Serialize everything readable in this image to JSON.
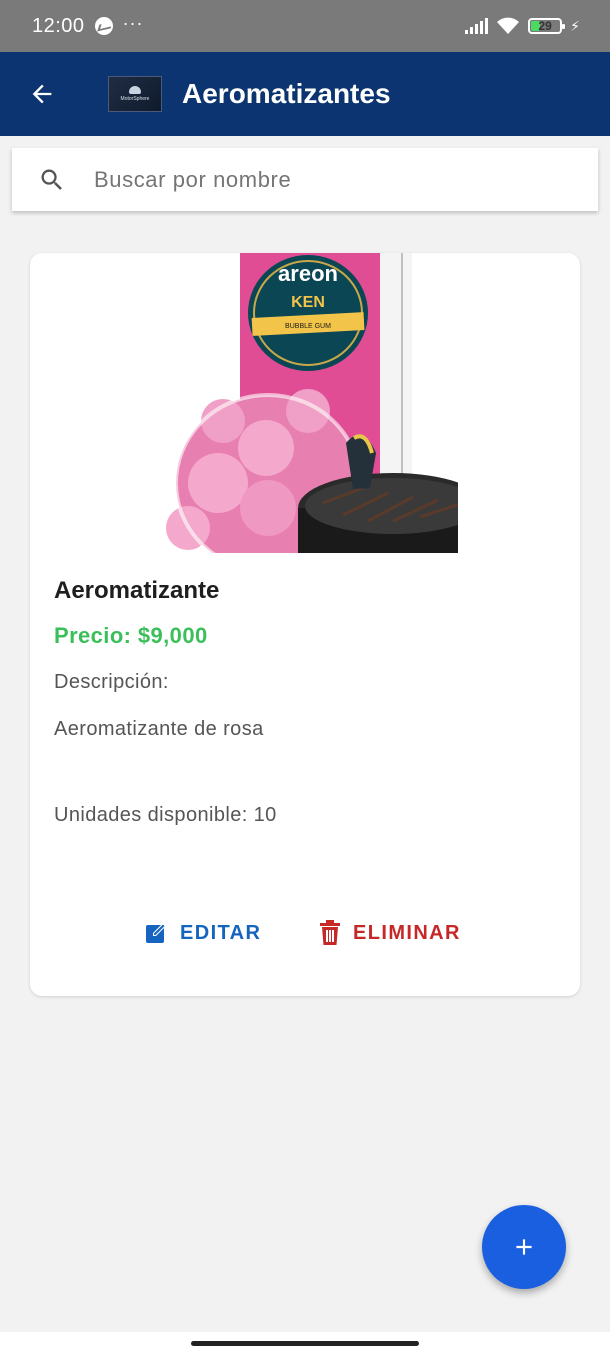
{
  "status_bar": {
    "time": "12:00",
    "dots": "···",
    "battery": "29",
    "battery_level": 0.29,
    "icons": [
      "messenger-icon",
      "signal-icon",
      "wifi-icon",
      "battery-icon",
      "charging-bolt-icon"
    ]
  },
  "app_bar": {
    "title": "Aeromatizantes",
    "logo_text": "MotorSphere",
    "back_icon": "arrow-left-icon",
    "background": "#0b3470"
  },
  "search": {
    "placeholder": "Buscar por nombre",
    "value": "",
    "icon": "search-icon"
  },
  "products": [
    {
      "name": "Aeromatizante",
      "price": "Precio: $9,000",
      "description_label": "Descripción:",
      "description": "Aeromatizante de rosa",
      "stock": "Unidades disponible: 10",
      "image_brand": "areon",
      "image_label": "KEN",
      "image_sub": "BUBBLE GUM",
      "edit_label": "EDITAR",
      "delete_label": "ELIMINAR"
    }
  ],
  "colors": {
    "price": "#3bbf5a",
    "edit": "#1565c0",
    "delete": "#c62828",
    "fab": "#1a5fe0"
  },
  "fab": {
    "icon": "plus-icon"
  }
}
